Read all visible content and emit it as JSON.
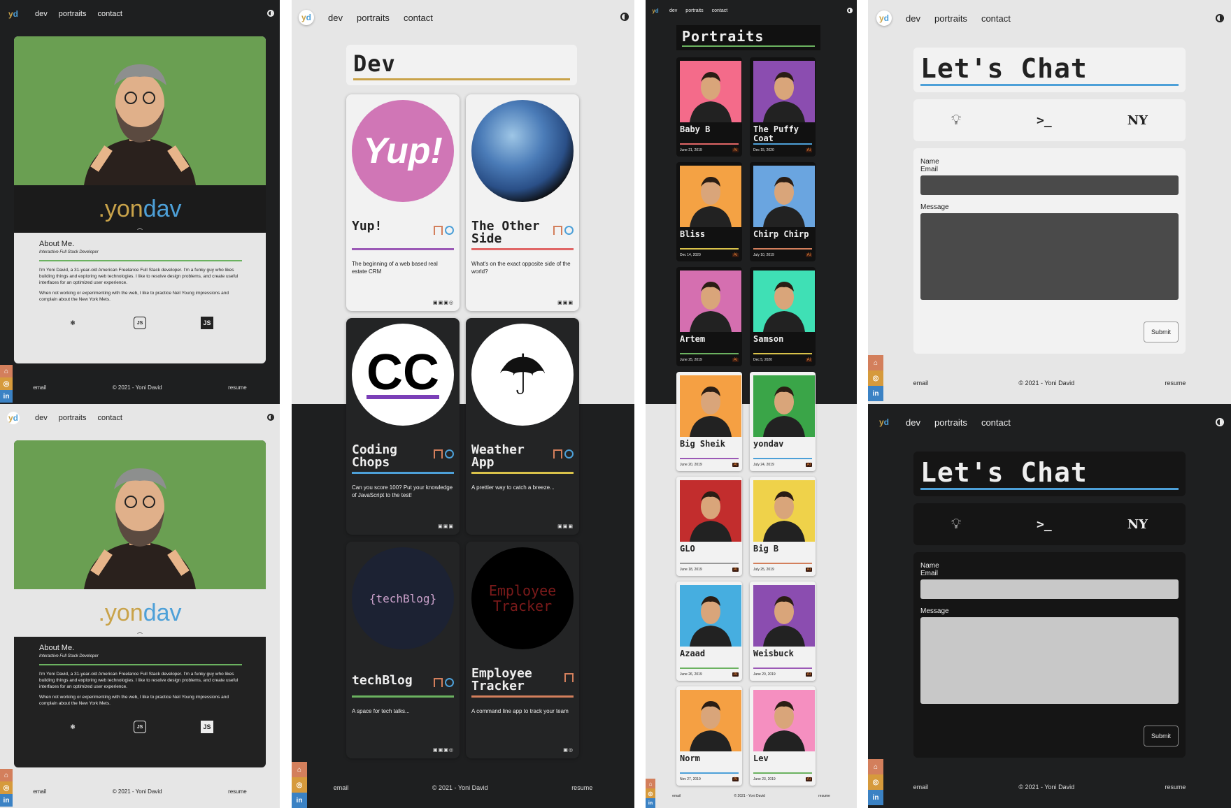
{
  "nav": {
    "logo_y": "y",
    "logo_d": "d",
    "dev": "dev",
    "portraits": "portraits",
    "contact": "contact"
  },
  "socials": {
    "github": "⌂",
    "instagram": "◎",
    "linkedin": "in"
  },
  "footer": {
    "email": "email",
    "copyright": "© 2021 - Yoni David",
    "resume": "resume"
  },
  "about": {
    "name_prefix": ".yon",
    "name_suffix": "dav",
    "heading": "About Me.",
    "subtitle": "Interactive Full Stack Developer",
    "p1": "I'm Yoni David, a 31-year-old American Freelance Full Stack developer. I'm a funky guy who likes building things and exploring web technologies. I like to resolve design problems, and create useful interfaces for an optimized user experience.",
    "p2": "When not working or experimenting with the web, I like to practice Neil Young impressions and complain about the New York Mets.",
    "tech": [
      "react-icon",
      "nodejs-icon",
      "javascript-icon"
    ],
    "tech_labels": {
      "js": "JS"
    }
  },
  "dev": {
    "title": "Dev",
    "projects": [
      {
        "name": "Yup!",
        "desc": "The beginning of a web based real estate CRM",
        "logo": "Yup!",
        "color": "#9b59b6"
      },
      {
        "name": "The Other Side",
        "desc": "What's on the exact opposite side of the world?",
        "logo": "",
        "color": "#e06666"
      },
      {
        "name": "Coding Chops",
        "desc": "Can you score 100? Put your knowledge of JavaScript to the test!",
        "logo": "CC",
        "color": "#4da0d8"
      },
      {
        "name": "Weather App",
        "desc": "A prettier way to catch a breeze...",
        "logo": "",
        "color": "#d9c24a"
      },
      {
        "name": "techBlog",
        "desc": "A space for tech talks...",
        "logo": "{techBlog}",
        "color": "#6bb260"
      },
      {
        "name": "Employee Tracker",
        "desc": "A command line app to track your team",
        "logo": "Employee Tracker",
        "color": "#d37f5c"
      }
    ]
  },
  "portraits": {
    "title": "Portraits",
    "ai_label": "Ai",
    "items": [
      {
        "name": "Baby B",
        "date": "June 21, 2019",
        "bg": "#f46b8a",
        "rule": "#e06666"
      },
      {
        "name": "The Puffy Coat",
        "date": "Dec 15, 2020",
        "bg": "#8b4db0",
        "rule": "#4da0d8"
      },
      {
        "name": "Bliss",
        "date": "Dec 14, 2020",
        "bg": "#f4a244",
        "rule": "#d9c24a"
      },
      {
        "name": "Chirp Chirp",
        "date": "July 10, 2019",
        "bg": "#6aa5e0",
        "rule": "#d37f5c"
      },
      {
        "name": "Artem",
        "date": "June 25, 2019",
        "bg": "#d56fb0",
        "rule": "#6bb260"
      },
      {
        "name": "Samson",
        "date": "Dec 5, 2020",
        "bg": "#3fe0b5",
        "rule": "#d9c24a"
      },
      {
        "name": "Big Sheik",
        "date": "June 20, 2019",
        "bg": "#f5a043",
        "rule": "#9b59b6"
      },
      {
        "name": "yondav",
        "date": "July 24, 2019",
        "bg": "#3aa548",
        "rule": "#4da0d8"
      },
      {
        "name": "GLO",
        "date": "June 18, 2019",
        "bg": "#c22d2d",
        "rule": "#999999"
      },
      {
        "name": "Big B",
        "date": "July 25, 2019",
        "bg": "#efd24a",
        "rule": "#d37f5c"
      },
      {
        "name": "Azaad",
        "date": "June 26, 2019",
        "bg": "#46aee0",
        "rule": "#6bb260"
      },
      {
        "name": "Weisbuck",
        "date": "June 20, 2019",
        "bg": "#8b4db0",
        "rule": "#9b59b6"
      },
      {
        "name": "Norm",
        "date": "Nov 27, 2019",
        "bg": "#f5a043",
        "rule": "#4da0d8"
      },
      {
        "name": "Lev",
        "date": "June 23, 2019",
        "bg": "#f58fc0",
        "rule": "#6bb260"
      }
    ]
  },
  "contact": {
    "title": "Let's Chat",
    "name_label": "Name",
    "email_label": "Email",
    "message_label": "Message",
    "submit": "Submit",
    "icons": [
      "lightbulb-icon",
      "terminal-icon",
      "mets-icon"
    ],
    "icon_glyphs": {
      "terminal": ">_",
      "mets": "NY"
    }
  }
}
